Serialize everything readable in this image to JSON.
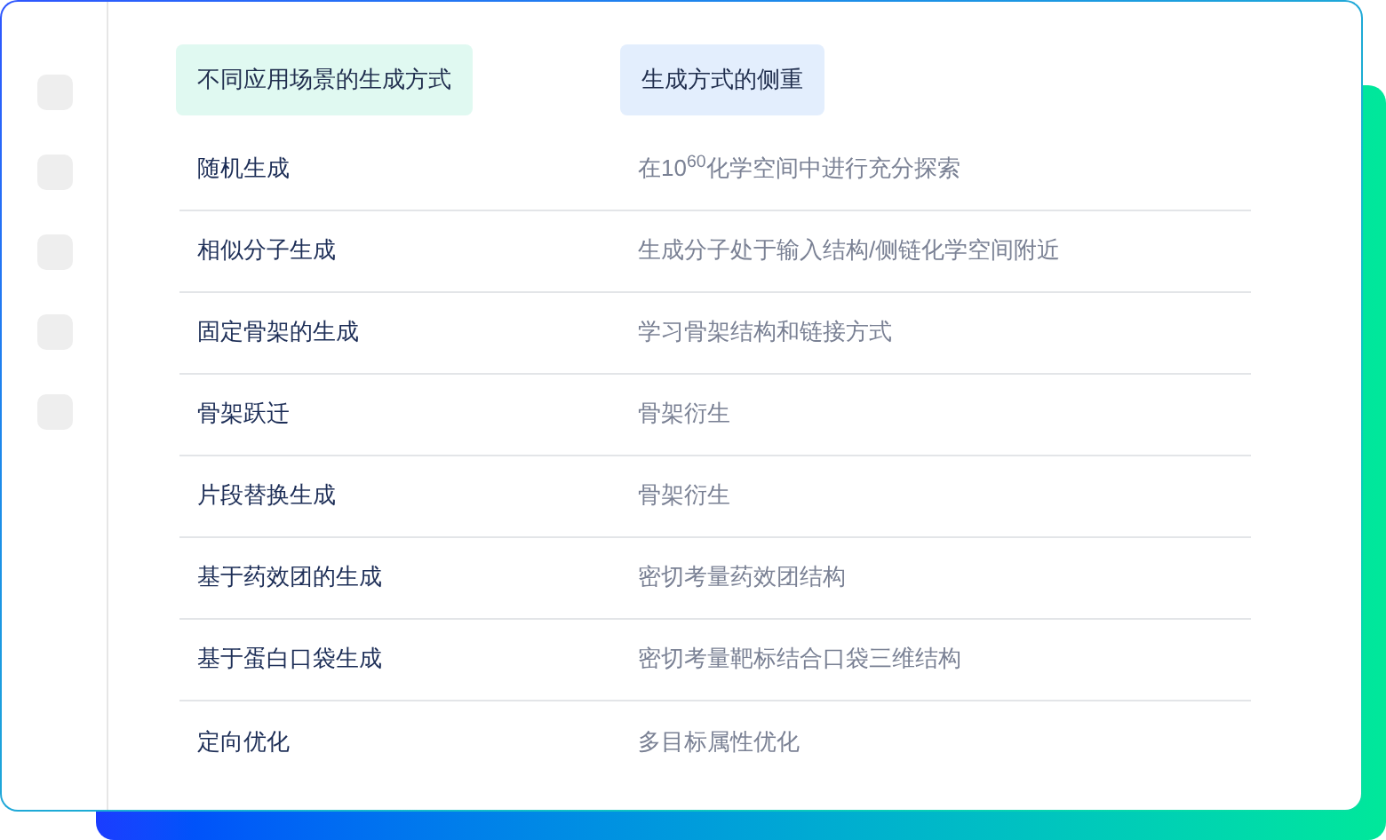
{
  "sidebar": {
    "items": [
      {
        "kind": "placeholder"
      },
      {
        "kind": "placeholder"
      },
      {
        "kind": "placeholder"
      },
      {
        "kind": "placeholder"
      },
      {
        "kind": "placeholder"
      }
    ]
  },
  "table": {
    "columns": [
      {
        "label": "不同应用场景的生成方式",
        "color": "#e0f9f1"
      },
      {
        "label": "生成方式的侧重",
        "color": "#e3eefd"
      }
    ],
    "rows": [
      {
        "cells": [
          "随机生成",
          "在10$^{60}$化学空间中进行充分探索"
        ]
      },
      {
        "cells": [
          "相似分子生成",
          "生成分子处于输入结构/侧链化学空间附近"
        ]
      },
      {
        "cells": [
          "固定骨架的生成",
          "学习骨架结构和链接方式"
        ]
      },
      {
        "cells": [
          "骨架跃迁",
          "骨架衍生"
        ]
      },
      {
        "cells": [
          "片段替换生成",
          "骨架衍生"
        ]
      },
      {
        "cells": [
          "基于药效团的生成",
          "密切考量药效团结构"
        ]
      },
      {
        "cells": [
          "基于蛋白口袋生成",
          "密切考量靶标结合口袋三维结构"
        ]
      },
      {
        "cells": [
          "定向优化",
          "多目标属性优化"
        ]
      }
    ]
  }
}
